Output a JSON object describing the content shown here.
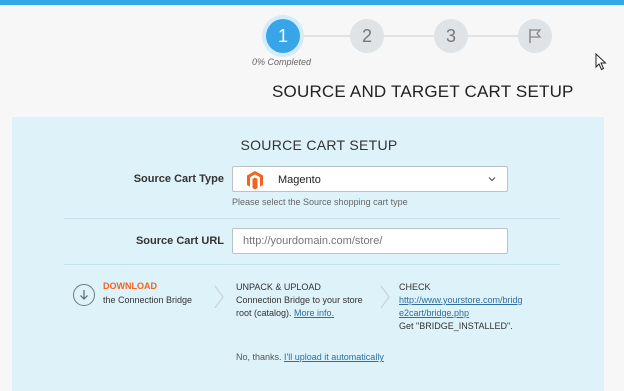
{
  "wizard": {
    "steps": [
      {
        "label": "1",
        "state": "active"
      },
      {
        "label": "2",
        "state": "pending"
      },
      {
        "label": "3",
        "state": "pending"
      }
    ],
    "final_step_icon": "flag-icon",
    "progress_text": "0% Completed",
    "progress_percent": 0
  },
  "page": {
    "title": "SOURCE AND TARGET CART SETUP"
  },
  "source_cart": {
    "section_title": "SOURCE CART SETUP",
    "type_label": "Source Cart Type",
    "type_value": "Magento",
    "type_icon": "magento-logo",
    "type_help": "Please select the Source shopping cart type",
    "url_label": "Source Cart URL",
    "url_placeholder": "http://yourdomain.com/store/",
    "url_value": ""
  },
  "bridge_steps": {
    "download": {
      "title": "DOWNLOAD",
      "subtitle": "the Connection Bridge",
      "icon": "download-icon"
    },
    "upload": {
      "title": "UNPACK & UPLOAD",
      "line1": "Connection Bridge to your store",
      "line2_prefix": "root (catalog).",
      "more_info": "More info."
    },
    "check": {
      "title": "CHECK",
      "url_line1": "http://www.yourstore.com/bridg",
      "url_line2": "e2cart/bridge.php",
      "expect": "Get \"BRIDGE_INSTALLED\"."
    }
  },
  "footer": {
    "prefix": "No, thanks.",
    "link": "I'll upload it automatically"
  },
  "colors": {
    "accent": "#37a5e8",
    "panel_bg": "#ddf2f9",
    "download_orange": "#f26322",
    "magento_orange": "#f26322"
  }
}
